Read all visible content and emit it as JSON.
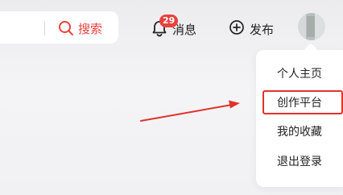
{
  "header": {
    "search_button_label": "搜索",
    "nav": {
      "messages_label": "消息",
      "messages_badge": "29",
      "publish_label": "发布"
    }
  },
  "dropdown": {
    "items": [
      {
        "label": "个人主页",
        "highlighted": false
      },
      {
        "label": "创作平台",
        "highlighted": true
      },
      {
        "label": "我的收藏",
        "highlighted": false
      },
      {
        "label": "退出登录",
        "highlighted": false
      }
    ]
  },
  "colors": {
    "accent": "#e8413c",
    "highlight_border": "#e2322b",
    "annotation_arrow": "#e2322b"
  }
}
